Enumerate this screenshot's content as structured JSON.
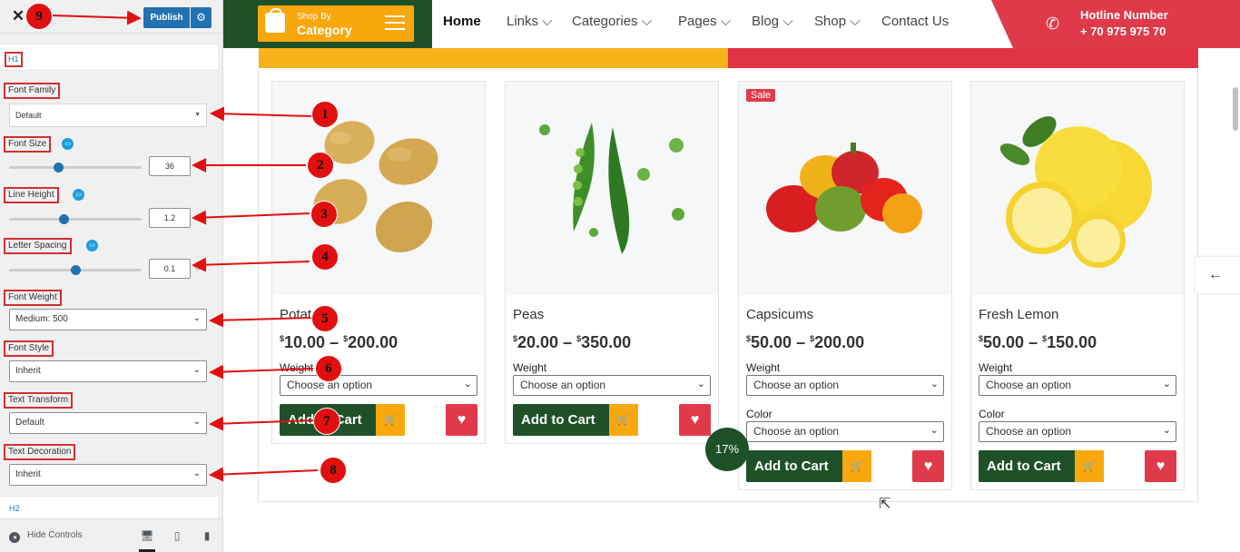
{
  "customizer": {
    "close_glyph": "✕",
    "publish_label": "Publish",
    "heading_h1": "H1",
    "heading_h2": "H2",
    "font_family": {
      "label": "Font Family",
      "value": "Default"
    },
    "font_size": {
      "label": "Font Size",
      "value": "36",
      "slider_fraction": 0.36
    },
    "line_height": {
      "label": "Line Height",
      "value": "1.2",
      "slider_fraction": 0.41
    },
    "letter_spacing": {
      "label": "Letter Spacing",
      "value": "0.1",
      "slider_fraction": 0.5
    },
    "font_weight": {
      "label": "Font Weight",
      "value": "Medium: 500"
    },
    "font_style": {
      "label": "Font Style",
      "value": "Inherit"
    },
    "text_transform": {
      "label": "Text Transform",
      "value": "Default"
    },
    "text_decoration": {
      "label": "Text Decoration",
      "value": "Inherit"
    },
    "hide_controls_label": "Hide Controls"
  },
  "annotations": [
    "1",
    "2",
    "3",
    "4",
    "5",
    "6",
    "7",
    "8",
    "9"
  ],
  "header": {
    "shop_by_line1": "Shop By",
    "shop_by_line2": "Category",
    "nav": [
      {
        "label": "Home"
      },
      {
        "label": "Links ⌵"
      },
      {
        "label": "Categories ⌵"
      },
      {
        "label": "Pages ⌵"
      },
      {
        "label": "Blog ⌵"
      },
      {
        "label": "Shop ⌵"
      },
      {
        "label": "Contact Us"
      }
    ],
    "hotline_label": "Hotline Number",
    "hotline_number": "+ 70 975 975 70"
  },
  "products": [
    {
      "name": "Potat",
      "price_from": "10.00",
      "price_to": "200.00",
      "currency": "$",
      "weight_label": "Weight",
      "placeholder": "Choose an option"
    },
    {
      "name": "Peas",
      "price_from": "20.00",
      "price_to": "350.00",
      "currency": "$",
      "weight_label": "Weight",
      "placeholder": "Choose an option"
    },
    {
      "name": "Capsicums",
      "price_from": "50.00",
      "price_to": "200.00",
      "currency": "$",
      "weight_label": "Weight",
      "color_label": "Color",
      "placeholder": "Choose an option",
      "badge": "Sale"
    },
    {
      "name": "Fresh Lemon",
      "price_from": "50.00",
      "price_to": "150.00",
      "currency": "$",
      "weight_label": "Weight",
      "color_label": "Color",
      "placeholder": "Choose an option"
    }
  ],
  "add_to_cart_label": "Add to Cart",
  "discount_badge": "17%",
  "price_separator": "–",
  "colors": {
    "green": "#1e5128",
    "orange": "#f8a70d",
    "red": "#e0394a",
    "wp_blue": "#2271b1"
  }
}
